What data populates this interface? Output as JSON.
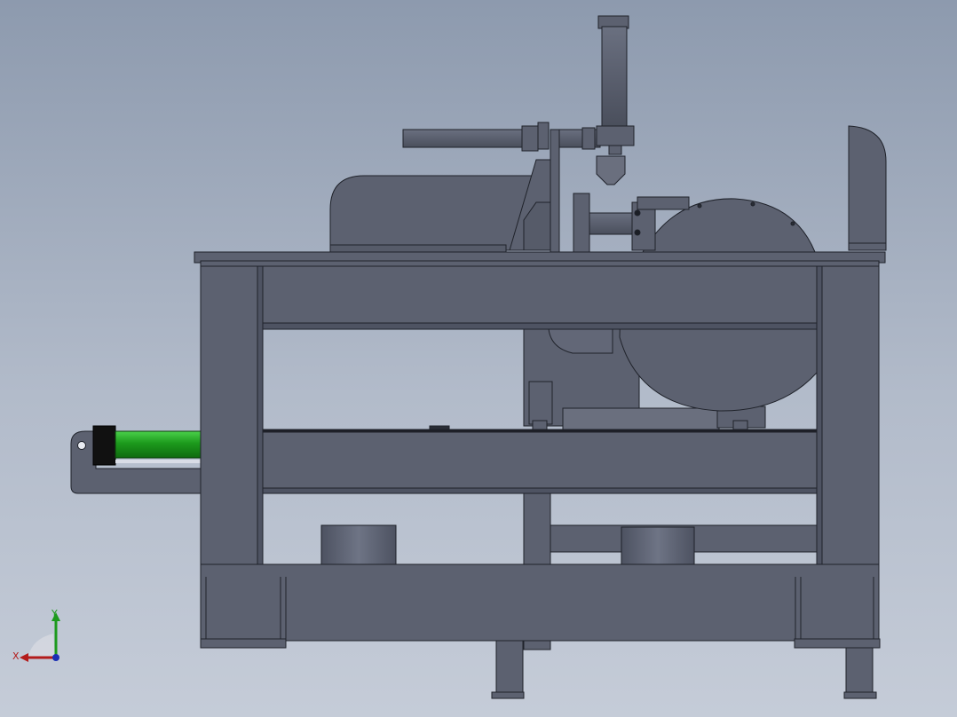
{
  "viewport": {
    "background_top": "#8d9aae",
    "background_bottom": "#c5ccd8"
  },
  "model": {
    "body_color": "#5c6170",
    "edge_color": "#1f222a",
    "cylinder_color": "#1c9a1c",
    "cylinder_cap_color": "#111111",
    "components": [
      "frame",
      "work-table",
      "motor",
      "saw-blade-guard",
      "overhead-arm",
      "vertical-cylinder",
      "pneumatic-cylinder",
      "pivot-bracket",
      "feet"
    ]
  },
  "triad": {
    "x_label": "X",
    "y_label": "Y",
    "x_color": "#b31b1b",
    "y_color": "#1d9a1d",
    "z_color": "#1b2fb3",
    "icon": "coordinate-triad-icon"
  }
}
